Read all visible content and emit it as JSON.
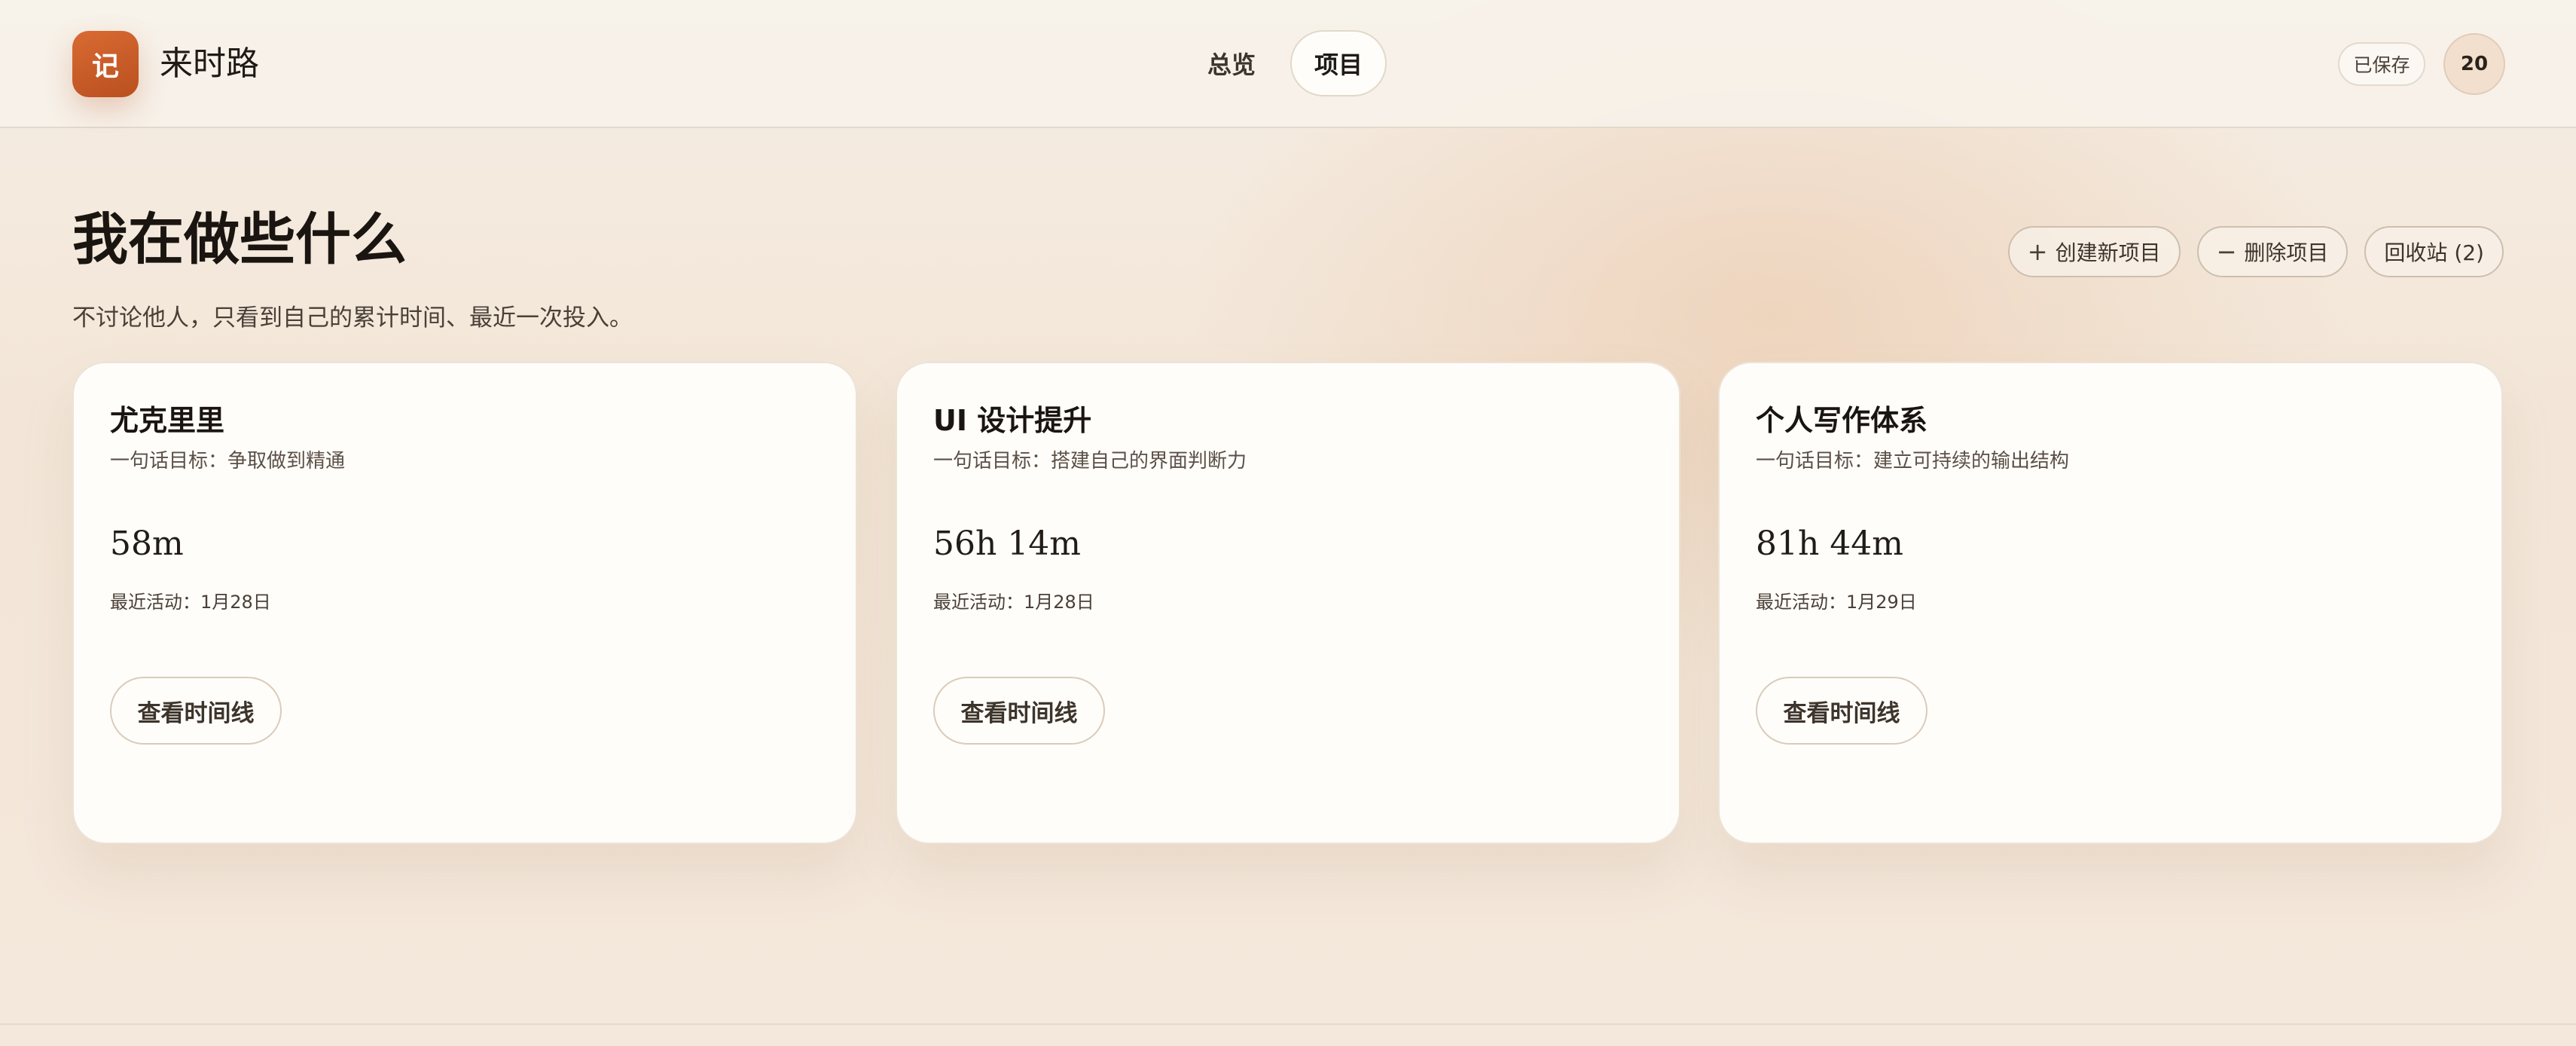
{
  "brand": {
    "logo_char": "记",
    "name": "来时路"
  },
  "nav": {
    "tabs": [
      {
        "label": "总览",
        "active": false
      },
      {
        "label": "项目",
        "active": true
      }
    ]
  },
  "header": {
    "saved_status": "已保存",
    "avatar_text": "20"
  },
  "page": {
    "title": "我在做些什么",
    "subtitle": "不讨论他人，只看到自己的累计时间、最近一次投入。"
  },
  "actions": {
    "create": {
      "icon": "+",
      "label": "创建新项目"
    },
    "delete": {
      "icon": "−",
      "label": "删除项目"
    },
    "trash": {
      "label": "回收站 (2)"
    }
  },
  "projects": [
    {
      "title": "尤克里里",
      "goal": "一句话目标：争取做到精通",
      "total_time": "58m",
      "last_activity": "最近活动：1月28日",
      "button": "查看时间线"
    },
    {
      "title": "UI 设计提升",
      "goal": "一句话目标：搭建自己的界面判断力",
      "total_time": "56h 14m",
      "last_activity": "最近活动：1月28日",
      "button": "查看时间线"
    },
    {
      "title": "个人写作体系",
      "goal": "一句话目标：建立可持续的输出结构",
      "total_time": "81h 44m",
      "last_activity": "最近活动：1月29日",
      "button": "查看时间线"
    }
  ],
  "colors": {
    "accent": "#c85a27",
    "background": "#f4e8dc",
    "card": "#fffdf9"
  }
}
